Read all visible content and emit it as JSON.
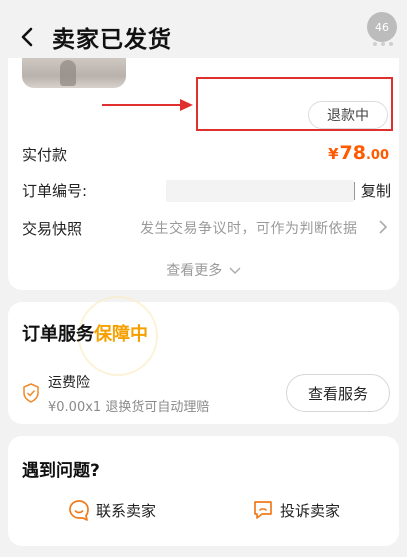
{
  "header": {
    "title": "卖家已发货",
    "badge_count": "46"
  },
  "order": {
    "refund_status": "退款中",
    "paid_label": "实付款",
    "paid_currency": "¥",
    "paid_integer": "78",
    "paid_decimal": ".00",
    "order_no_label": "订单编号:",
    "copy_label": "复制",
    "snapshot_label": "交易快照",
    "snapshot_hint": "发生交易争议时，可作为判断依据",
    "see_more": "查看更多"
  },
  "service": {
    "title": "订单服务",
    "status": "保障中",
    "insurance_name": "运费险",
    "insurance_desc": "¥0.00x1 退换货可自动理赔",
    "view_button": "查看服务"
  },
  "help": {
    "title": "遇到问题?",
    "contact_seller": "联系卖家",
    "complain_seller": "投诉卖家"
  },
  "colors": {
    "accent_orange": "#ff5a00",
    "status_yellow": "#f5a000",
    "highlight_red": "#e0302d"
  },
  "icons": {
    "back": "chevron-left-icon",
    "more": "more-dots-icon",
    "shield": "shield-check-icon",
    "contact": "chat-smile-icon",
    "complain": "complaint-chat-icon"
  }
}
